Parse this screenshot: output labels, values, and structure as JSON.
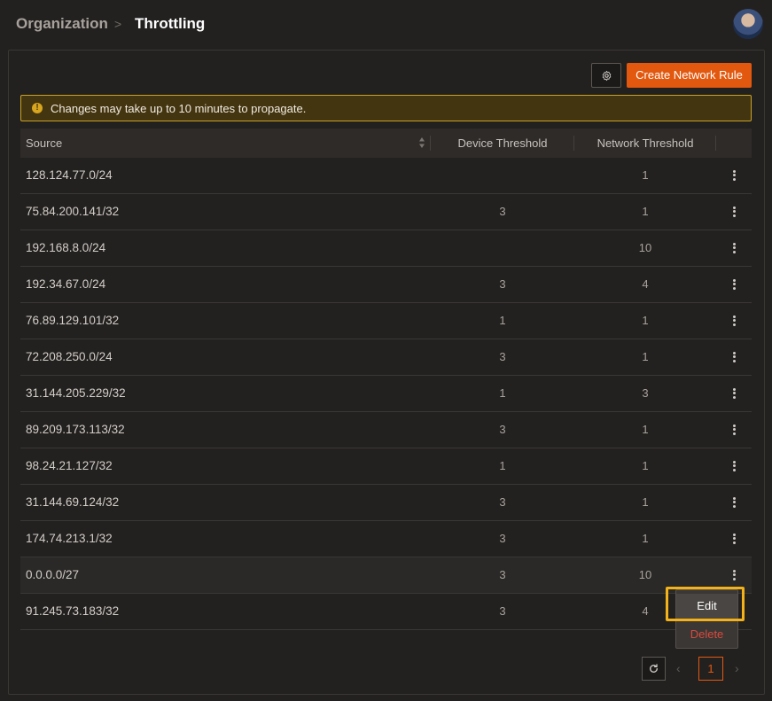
{
  "breadcrumb": {
    "root": "Organization",
    "separator": ">",
    "current": "Throttling"
  },
  "toolbar": {
    "settings_icon": "gear-icon",
    "create_label": "Create Network Rule"
  },
  "alert": {
    "icon": "info-icon",
    "icon_glyph": "!",
    "message": "Changes may take up to 10 minutes to propagate."
  },
  "table": {
    "headers": {
      "source": "Source",
      "device": "Device Threshold",
      "network": "Network Threshold"
    },
    "rows": [
      {
        "source": "128.124.77.0/24",
        "device": "",
        "network": "1"
      },
      {
        "source": "75.84.200.141/32",
        "device": "3",
        "network": "1"
      },
      {
        "source": "192.168.8.0/24",
        "device": "",
        "network": "10"
      },
      {
        "source": "192.34.67.0/24",
        "device": "3",
        "network": "4"
      },
      {
        "source": "76.89.129.101/32",
        "device": "1",
        "network": "1"
      },
      {
        "source": "72.208.250.0/24",
        "device": "3",
        "network": "1"
      },
      {
        "source": "31.144.205.229/32",
        "device": "1",
        "network": "3"
      },
      {
        "source": "89.209.173.113/32",
        "device": "3",
        "network": "1"
      },
      {
        "source": "98.24.21.127/32",
        "device": "1",
        "network": "1"
      },
      {
        "source": "31.144.69.124/32",
        "device": "3",
        "network": "1"
      },
      {
        "source": "174.74.213.1/32",
        "device": "3",
        "network": "1"
      },
      {
        "source": "0.0.0.0/27",
        "device": "3",
        "network": "10"
      },
      {
        "source": "91.245.73.183/32",
        "device": "3",
        "network": "4"
      }
    ]
  },
  "context_menu": {
    "edit_label": "Edit",
    "delete_label": "Delete"
  },
  "pagination": {
    "prev": "‹",
    "current_page": "1",
    "next": "›"
  },
  "colors": {
    "accent": "#e2580f",
    "warning_border": "#c9a228",
    "focus": "#f4b21a",
    "danger": "#d94a3c"
  }
}
